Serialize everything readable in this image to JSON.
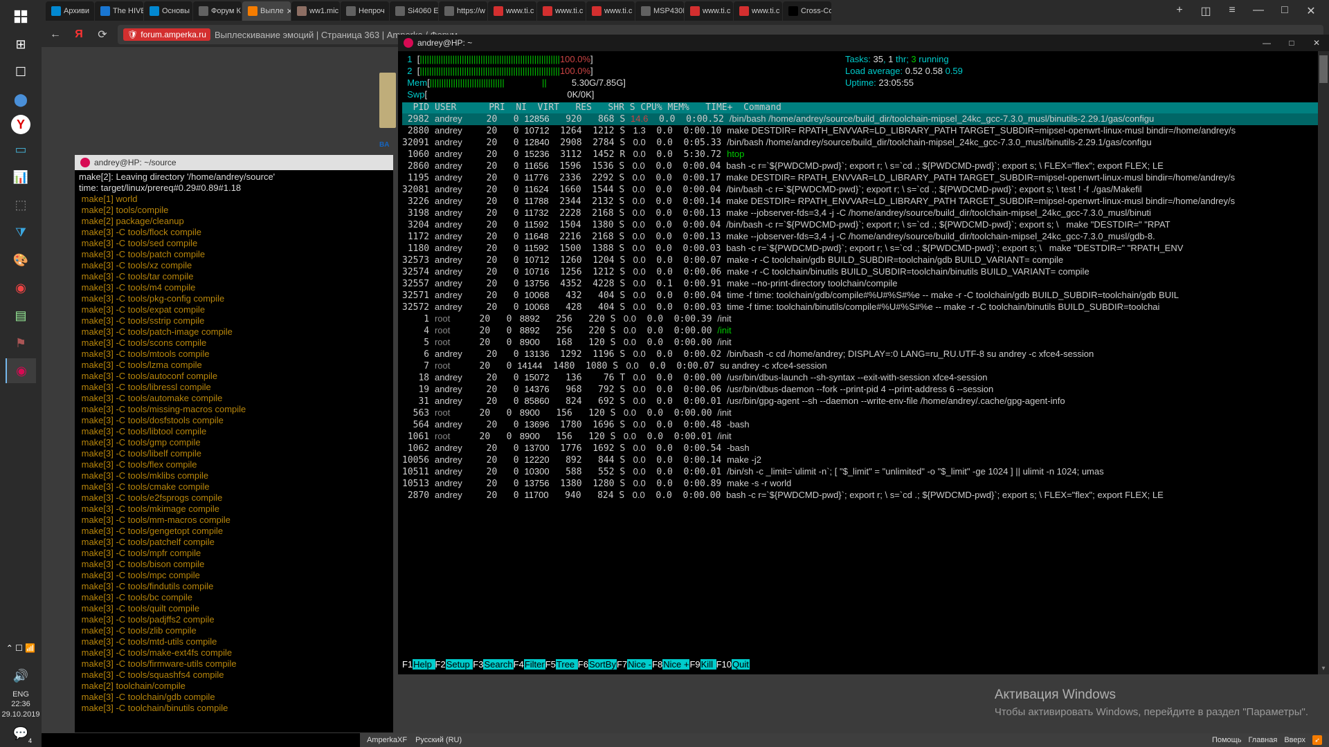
{
  "taskbar": {
    "items": [
      "start",
      "task-view",
      "search",
      "app1",
      "edge",
      "yandex",
      "app2",
      "app3",
      "app4",
      "app5",
      "vscode",
      "palette",
      "debian-red",
      "files",
      "flag",
      "debian-pink"
    ],
    "tray": {
      "lang": "ENG",
      "time": "22:36",
      "date": "29.10.2019",
      "notif": "4"
    }
  },
  "tabs": [
    {
      "fav": "tc-teal",
      "label": "Архиви"
    },
    {
      "fav": "tc-blue",
      "label": "The HIVE"
    },
    {
      "fav": "tc-teal",
      "label": "Основы"
    },
    {
      "fav": "tc-gray",
      "label": "Форум К"
    },
    {
      "fav": "tc-orange",
      "label": "Выпле",
      "sel": true,
      "close": true
    },
    {
      "fav": "tc-tan",
      "label": "ww1.mic"
    },
    {
      "fav": "tc-gray",
      "label": "Непроч"
    },
    {
      "fav": "tc-gray",
      "label": "Si4060 E"
    },
    {
      "fav": "tc-gray",
      "label": "https://w"
    },
    {
      "fav": "tc-red",
      "label": "www.ti.c"
    },
    {
      "fav": "tc-red",
      "label": "www.ti.c"
    },
    {
      "fav": "tc-red",
      "label": "www.ti.c"
    },
    {
      "fav": "tc-gray",
      "label": "MSP430I"
    },
    {
      "fav": "tc-red",
      "label": "www.ti.c"
    },
    {
      "fav": "tc-red",
      "label": "www.ti.c"
    },
    {
      "fav": "tc-black",
      "label": "Cross-Co"
    }
  ],
  "toolbar": {
    "host": "forum.amperka.ru",
    "path": "Выплескивание эмоций | Страница 363 | Amperka / Форум"
  },
  "footer": {
    "left": [
      "AmperkaXF",
      "Русский (RU)"
    ],
    "right": [
      "Помощь",
      "Главная",
      "Вверх"
    ]
  },
  "watermark": {
    "l1": "Активация Windows",
    "l2": "Чтобы активировать Windows, перейдите в раздел \"Параметры\"."
  },
  "left_term": {
    "title": "andrey@HP: ~/source",
    "pre": [
      "make[2]: Leaving directory '/home/andrey/source'",
      "time: target/linux/prereq#0.29#0.89#1.18"
    ],
    "lines": [
      " make[1] world",
      " make[2] tools/compile",
      " make[2] package/cleanup",
      " make[3] -C tools/flock compile",
      " make[3] -C tools/sed compile",
      " make[3] -C tools/patch compile",
      " make[3] -C tools/xz compile",
      " make[3] -C tools/tar compile",
      " make[3] -C tools/m4 compile",
      " make[3] -C tools/pkg-config compile",
      " make[3] -C tools/expat compile",
      " make[3] -C tools/sstrip compile",
      " make[3] -C tools/patch-image compile",
      " make[3] -C tools/scons compile",
      " make[3] -C tools/mtools compile",
      " make[3] -C tools/lzma compile",
      " make[3] -C tools/autoconf compile",
      " make[3] -C tools/libressl compile",
      " make[3] -C tools/automake compile",
      " make[3] -C tools/missing-macros compile",
      " make[3] -C tools/dosfstools compile",
      " make[3] -C tools/libtool compile",
      " make[3] -C tools/gmp compile",
      " make[3] -C tools/libelf compile",
      " make[3] -C tools/flex compile",
      " make[3] -C tools/mklibs compile",
      " make[3] -C tools/cmake compile",
      " make[3] -C tools/e2fsprogs compile",
      " make[3] -C tools/mkimage compile",
      " make[3] -C tools/mm-macros compile",
      " make[3] -C tools/gengetopt compile",
      " make[3] -C tools/patchelf compile",
      " make[3] -C tools/mpfr compile",
      " make[3] -C tools/bison compile",
      " make[3] -C tools/mpc compile",
      " make[3] -C tools/findutils compile",
      " make[3] -C tools/bc compile",
      " make[3] -C tools/quilt compile",
      " make[3] -C tools/padjffs2 compile",
      " make[3] -C tools/zlib compile",
      " make[3] -C tools/mtd-utils compile",
      " make[3] -C tools/make-ext4fs compile",
      " make[3] -C tools/firmware-utils compile",
      " make[3] -C tools/squashfs4 compile",
      " make[2] toolchain/compile",
      " make[3] -C toolchain/gdb compile",
      " make[3] -C toolchain/binutils compile"
    ]
  },
  "htop": {
    "title": "andrey@HP: ~",
    "cpu": [
      {
        "n": "1",
        "fill": "||||||||||||||||||||||||||||||||||||||||||||||||||||||||||||",
        "pct": "100.0%"
      },
      {
        "n": "2",
        "fill": "||||||||||||||||||||||||||||||||||||||||||||||||||||||||||||",
        "pct": "100.0%"
      }
    ],
    "mem": {
      "label": "Mem",
      "bar": "||||||||||||||||||||||||||||||||               ||",
      "val": "5.30G/7.85G"
    },
    "swp": {
      "label": "Swp",
      "bar": "",
      "val": "0K/0K"
    },
    "tasks": "Tasks: 35, 1 thr; 3 running",
    "tasks_parts": {
      "p1": "Tasks: ",
      "n1": "35",
      "p2": ", ",
      "n2": "1",
      "p3": " thr; ",
      "n3": "3",
      "p4": " running"
    },
    "load_parts": {
      "p1": "Load average: ",
      "a": "0.52",
      "b": "0.58",
      "c": "0.59"
    },
    "uptime_parts": {
      "p1": "Uptime: ",
      "v": "23:05:55"
    },
    "head": "  PID USER      PRI  NI  VIRT   RES   SHR S CPU% MEM%   TIME+  Command",
    "rows": [
      {
        "pid": " 2982",
        "u": "andrey",
        "pri": "20",
        "ni": "0",
        "virt": "12856",
        "res": "920",
        "shr": "868",
        "s": "S",
        "cpu": "14.6",
        "mem": "0.0",
        "time": "0:00.52",
        "cmd": "/bin/bash /home/andrey/source/build_dir/toolchain-mipsel_24kc_gcc-7.3.0_musl/binutils-2.29.1/gas/configu",
        "sel": true
      },
      {
        "pid": " 2880",
        "u": "andrey",
        "pri": "20",
        "ni": "0",
        "virt": "10712",
        "res": "1264",
        "shr": "1212",
        "s": "S",
        "cpu": "1.3",
        "mem": "0.0",
        "time": "0:00.10",
        "cmd": "make DESTDIR= RPATH_ENVVAR=LD_LIBRARY_PATH TARGET_SUBDIR=mipsel-openwrt-linux-musl bindir=/home/andrey/s"
      },
      {
        "pid": "32091",
        "u": "andrey",
        "pri": "20",
        "ni": "0",
        "virt": "12840",
        "res": "2908",
        "shr": "2784",
        "s": "S",
        "cpu": "0.0",
        "mem": "0.0",
        "time": "0:05.33",
        "cmd": "/bin/bash /home/andrey/source/build_dir/toolchain-mipsel_24kc_gcc-7.3.0_musl/binutils-2.29.1/gas/configu"
      },
      {
        "pid": " 1060",
        "u": "andrey",
        "pri": "20",
        "ni": "0",
        "virt": "15236",
        "res": "3112",
        "shr": "1452",
        "s": "R",
        "cpu": "0.0",
        "mem": "0.0",
        "time": "5:30.72",
        "cmd": "htop",
        "g": true
      },
      {
        "pid": " 2860",
        "u": "andrey",
        "pri": "20",
        "ni": "0",
        "virt": "11656",
        "res": "1596",
        "shr": "1536",
        "s": "S",
        "cpu": "0.0",
        "mem": "0.0",
        "time": "0:00.04",
        "cmd": "bash -c r=`${PWDCMD-pwd}`; export r; \\ s=`cd .; ${PWDCMD-pwd}`; export s; \\ FLEX=\"flex\"; export FLEX; LE"
      },
      {
        "pid": " 1195",
        "u": "andrey",
        "pri": "20",
        "ni": "0",
        "virt": "11776",
        "res": "2336",
        "shr": "2292",
        "s": "S",
        "cpu": "0.0",
        "mem": "0.0",
        "time": "0:00.17",
        "cmd": "make DESTDIR= RPATH_ENVVAR=LD_LIBRARY_PATH TARGET_SUBDIR=mipsel-openwrt-linux-musl bindir=/home/andrey/s"
      },
      {
        "pid": "32081",
        "u": "andrey",
        "pri": "20",
        "ni": "0",
        "virt": "11624",
        "res": "1660",
        "shr": "1544",
        "s": "S",
        "cpu": "0.0",
        "mem": "0.0",
        "time": "0:00.04",
        "cmd": "/bin/bash -c r=`${PWDCMD-pwd}`; export r; \\ s=`cd .; ${PWDCMD-pwd}`; export s; \\ test ! -f ./gas/Makefil"
      },
      {
        "pid": " 3226",
        "u": "andrey",
        "pri": "20",
        "ni": "0",
        "virt": "11788",
        "res": "2344",
        "shr": "2132",
        "s": "S",
        "cpu": "0.0",
        "mem": "0.0",
        "time": "0:00.14",
        "cmd": "make DESTDIR= RPATH_ENVVAR=LD_LIBRARY_PATH TARGET_SUBDIR=mipsel-openwrt-linux-musl bindir=/home/andrey/s"
      },
      {
        "pid": " 3198",
        "u": "andrey",
        "pri": "20",
        "ni": "0",
        "virt": "11732",
        "res": "2228",
        "shr": "2168",
        "s": "S",
        "cpu": "0.0",
        "mem": "0.0",
        "time": "0:00.13",
        "cmd": "make --jobserver-fds=3,4 -j -C /home/andrey/source/build_dir/toolchain-mipsel_24kc_gcc-7.3.0_musl/binuti"
      },
      {
        "pid": " 3204",
        "u": "andrey",
        "pri": "20",
        "ni": "0",
        "virt": "11592",
        "res": "1504",
        "shr": "1380",
        "s": "S",
        "cpu": "0.0",
        "mem": "0.0",
        "time": "0:00.04",
        "cmd": "/bin/bash -c r=`${PWDCMD-pwd}`; export r; \\ s=`cd .; ${PWDCMD-pwd}`; export s; \\   make \"DESTDIR=\" \"RPAT"
      },
      {
        "pid": " 1172",
        "u": "andrey",
        "pri": "20",
        "ni": "0",
        "virt": "11648",
        "res": "2216",
        "shr": "2168",
        "s": "S",
        "cpu": "0.0",
        "mem": "0.0",
        "time": "0:00.13",
        "cmd": "make --jobserver-fds=3,4 -j -C /home/andrey/source/build_dir/toolchain-mipsel_24kc_gcc-7.3.0_musl/gdb-8."
      },
      {
        "pid": " 1180",
        "u": "andrey",
        "pri": "20",
        "ni": "0",
        "virt": "11592",
        "res": "1500",
        "shr": "1388",
        "s": "S",
        "cpu": "0.0",
        "mem": "0.0",
        "time": "0:00.03",
        "cmd": "bash -c r=`${PWDCMD-pwd}`; export r; \\ s=`cd .; ${PWDCMD-pwd}`; export s; \\   make \"DESTDIR=\" \"RPATH_ENV"
      },
      {
        "pid": "32573",
        "u": "andrey",
        "pri": "20",
        "ni": "0",
        "virt": "10712",
        "res": "1260",
        "shr": "1204",
        "s": "S",
        "cpu": "0.0",
        "mem": "0.0",
        "time": "0:00.07",
        "cmd": "make -r -C toolchain/gdb BUILD_SUBDIR=toolchain/gdb BUILD_VARIANT= compile"
      },
      {
        "pid": "32574",
        "u": "andrey",
        "pri": "20",
        "ni": "0",
        "virt": "10716",
        "res": "1256",
        "shr": "1212",
        "s": "S",
        "cpu": "0.0",
        "mem": "0.0",
        "time": "0:00.06",
        "cmd": "make -r -C toolchain/binutils BUILD_SUBDIR=toolchain/binutils BUILD_VARIANT= compile"
      },
      {
        "pid": "32557",
        "u": "andrey",
        "pri": "20",
        "ni": "0",
        "virt": "13756",
        "res": "4352",
        "shr": "4228",
        "s": "S",
        "cpu": "0.0",
        "mem": "0.1",
        "time": "0:00.91",
        "cmd": "make --no-print-directory toolchain/compile"
      },
      {
        "pid": "32571",
        "u": "andrey",
        "pri": "20",
        "ni": "0",
        "virt": "10068",
        "res": "432",
        "shr": "404",
        "s": "S",
        "cpu": "0.0",
        "mem": "0.0",
        "time": "0:00.04",
        "cmd": "time -f time: toolchain/gdb/compile#%U#%S#%e -- make -r -C toolchain/gdb BUILD_SUBDIR=toolchain/gdb BUIL"
      },
      {
        "pid": "32572",
        "u": "andrey",
        "pri": "20",
        "ni": "0",
        "virt": "10068",
        "res": "428",
        "shr": "404",
        "s": "S",
        "cpu": "0.0",
        "mem": "0.0",
        "time": "0:00.03",
        "cmd": "time -f time: toolchain/binutils/compile#%U#%S#%e -- make -r -C toolchain/binutils BUILD_SUBDIR=toolchai"
      },
      {
        "pid": "    1",
        "u": "root",
        "pri": "20",
        "ni": "0",
        "virt": "8892",
        "res": "256",
        "shr": "220",
        "s": "S",
        "cpu": "0.0",
        "mem": "0.0",
        "time": "0:00.39",
        "cmd": "/init",
        "root": true
      },
      {
        "pid": "    4",
        "u": "root",
        "pri": "20",
        "ni": "0",
        "virt": "8892",
        "res": "256",
        "shr": "220",
        "s": "S",
        "cpu": "0.0",
        "mem": "0.0",
        "time": "0:00.00",
        "cmd": "/init",
        "root": true,
        "g": true
      },
      {
        "pid": "    5",
        "u": "root",
        "pri": "20",
        "ni": "0",
        "virt": "8900",
        "res": "168",
        "shr": "120",
        "s": "S",
        "cpu": "0.0",
        "mem": "0.0",
        "time": "0:00.00",
        "cmd": "/init",
        "root": true
      },
      {
        "pid": "    6",
        "u": "andrey",
        "pri": "20",
        "ni": "0",
        "virt": "13136",
        "res": "1292",
        "shr": "1196",
        "s": "S",
        "cpu": "0.0",
        "mem": "0.0",
        "time": "0:00.02",
        "cmd": "/bin/bash -c cd /home/andrey; DISPLAY=:0 LANG=ru_RU.UTF-8 su andrey -c xfce4-session"
      },
      {
        "pid": "    7",
        "u": "root",
        "pri": "20",
        "ni": "0",
        "virt": "14144",
        "res": "1480",
        "shr": "1080",
        "s": "S",
        "cpu": "0.0",
        "mem": "0.0",
        "time": "0:00.07",
        "cmd": "su andrey -c xfce4-session",
        "root": true
      },
      {
        "pid": "   18",
        "u": "andrey",
        "pri": "20",
        "ni": "0",
        "virt": "15072",
        "res": "136",
        "shr": "76",
        "s": "T",
        "cpu": "0.0",
        "mem": "0.0",
        "time": "0:00.00",
        "cmd": "/usr/bin/dbus-launch --sh-syntax --exit-with-session xfce4-session"
      },
      {
        "pid": "   19",
        "u": "andrey",
        "pri": "20",
        "ni": "0",
        "virt": "14376",
        "res": "968",
        "shr": "792",
        "s": "S",
        "cpu": "0.0",
        "mem": "0.0",
        "time": "0:00.06",
        "cmd": "/usr/bin/dbus-daemon --fork --print-pid 4 --print-address 6 --session"
      },
      {
        "pid": "   31",
        "u": "andrey",
        "pri": "20",
        "ni": "0",
        "virt": "85860",
        "res": "824",
        "shr": "692",
        "s": "S",
        "cpu": "0.0",
        "mem": "0.0",
        "time": "0:00.01",
        "cmd": "/usr/bin/gpg-agent --sh --daemon --write-env-file /home/andrey/.cache/gpg-agent-info"
      },
      {
        "pid": "  563",
        "u": "root",
        "pri": "20",
        "ni": "0",
        "virt": "8900",
        "res": "156",
        "shr": "120",
        "s": "S",
        "cpu": "0.0",
        "mem": "0.0",
        "time": "0:00.00",
        "cmd": "/init",
        "root": true
      },
      {
        "pid": "  564",
        "u": "andrey",
        "pri": "20",
        "ni": "0",
        "virt": "13696",
        "res": "1780",
        "shr": "1696",
        "s": "S",
        "cpu": "0.0",
        "mem": "0.0",
        "time": "0:00.48",
        "cmd": "-bash"
      },
      {
        "pid": " 1061",
        "u": "root",
        "pri": "20",
        "ni": "0",
        "virt": "8900",
        "res": "156",
        "shr": "120",
        "s": "S",
        "cpu": "0.0",
        "mem": "0.0",
        "time": "0:00.01",
        "cmd": "/init",
        "root": true
      },
      {
        "pid": " 1062",
        "u": "andrey",
        "pri": "20",
        "ni": "0",
        "virt": "13700",
        "res": "1776",
        "shr": "1692",
        "s": "S",
        "cpu": "0.0",
        "mem": "0.0",
        "time": "0:00.54",
        "cmd": "-bash"
      },
      {
        "pid": "10056",
        "u": "andrey",
        "pri": "20",
        "ni": "0",
        "virt": "12220",
        "res": "892",
        "shr": "844",
        "s": "S",
        "cpu": "0.0",
        "mem": "0.0",
        "time": "0:00.14",
        "cmd": "make -j2"
      },
      {
        "pid": "10511",
        "u": "andrey",
        "pri": "20",
        "ni": "0",
        "virt": "10300",
        "res": "588",
        "shr": "552",
        "s": "S",
        "cpu": "0.0",
        "mem": "0.0",
        "time": "0:00.01",
        "cmd": "/bin/sh -c _limit=`ulimit -n`; [ \"$_limit\" = \"unlimited\" -o \"$_limit\" -ge 1024 ] || ulimit -n 1024; umas"
      },
      {
        "pid": "10513",
        "u": "andrey",
        "pri": "20",
        "ni": "0",
        "virt": "13756",
        "res": "1380",
        "shr": "1280",
        "s": "S",
        "cpu": "0.0",
        "mem": "0.0",
        "time": "0:00.89",
        "cmd": "make -s -r world"
      },
      {
        "pid": " 2870",
        "u": "andrey",
        "pri": "20",
        "ni": "0",
        "virt": "11700",
        "res": "940",
        "shr": "824",
        "s": "S",
        "cpu": "0.0",
        "mem": "0.0",
        "time": "0:00.00",
        "cmd": "bash -c r=`${PWDCMD-pwd}`; export r; \\ s=`cd .; ${PWDCMD-pwd}`; export s; \\ FLEX=\"flex\"; export FLEX; LE"
      }
    ],
    "fn": [
      {
        "k": "F1",
        "l": "Help  "
      },
      {
        "k": "F2",
        "l": "Setup "
      },
      {
        "k": "F3",
        "l": "Search"
      },
      {
        "k": "F4",
        "l": "Filter"
      },
      {
        "k": "F5",
        "l": "Tree  "
      },
      {
        "k": "F6",
        "l": "SortBy"
      },
      {
        "k": "F7",
        "l": "Nice -"
      },
      {
        "k": "F8",
        "l": "Nice +"
      },
      {
        "k": "F9",
        "l": "Kill  "
      },
      {
        "k": "F10",
        "l": "Quit  "
      }
    ]
  }
}
